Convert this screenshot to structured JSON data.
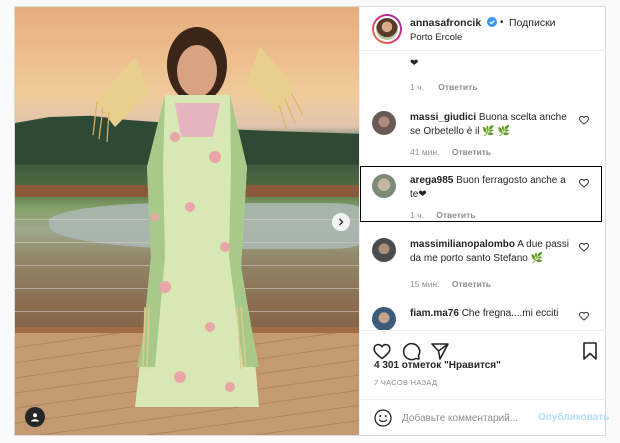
{
  "header": {
    "username": "annasafroncik",
    "separator": "•",
    "follow_label": "Подписки",
    "location": "Porto Ercole"
  },
  "top_comment": {
    "text": "❤",
    "time": "1 ч.",
    "reply": "Ответить"
  },
  "comments": [
    {
      "user": "massi_giudici",
      "text": "Buona scelta anche se Orbetello è il 🌿 🌿",
      "time": "41 мин.",
      "reply": "Ответить"
    },
    {
      "user": "arega985",
      "text": "Buon ferragosto anche a te❤",
      "time": "1 ч.",
      "reply": "Ответить"
    },
    {
      "user": "massimilianopalombo",
      "text": "A due passi da me porto santo Stefano 🌿",
      "time": "15 мин.",
      "reply": "Ответить"
    },
    {
      "user": "fiam.ma76",
      "text": "Che fregna....mi ecciti",
      "time": "",
      "reply": ""
    }
  ],
  "likes": "4 301 отметок \"Нравится\"",
  "time_ago": "7 ЧАСОВ НАЗАД",
  "composer": {
    "placeholder": "Добавьте комментарий...",
    "publish_label": "Опубликовать"
  },
  "icons": {
    "like": "heart-icon",
    "comment": "comment-icon",
    "share": "share-icon",
    "save": "bookmark-icon",
    "emoji": "emoji-icon",
    "verified": "verified-badge-icon",
    "next": "chevron-right-icon",
    "tag": "user-tag-icon"
  },
  "colors": {
    "accent": "#0095f6",
    "publish_disabled": "#b2dffc",
    "meta_gray": "#8e8e8e",
    "border": "#dbdbdb"
  }
}
